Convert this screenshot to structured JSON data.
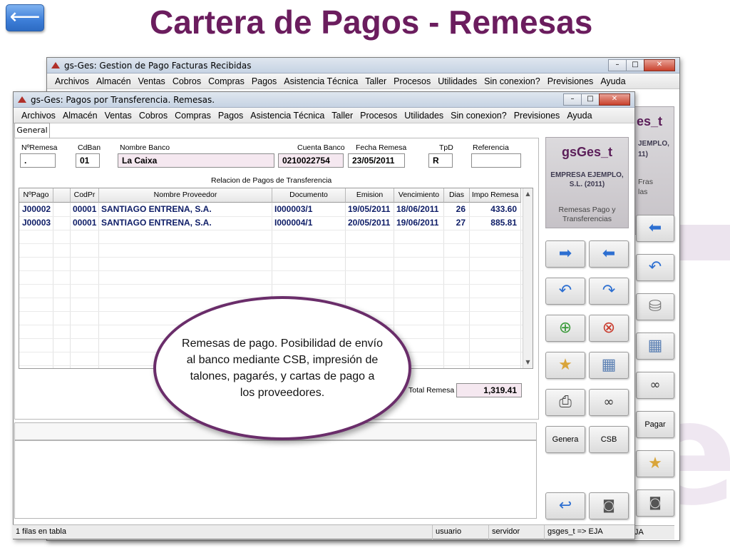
{
  "slide": {
    "title": "Cartera de Pagos - Remesas",
    "back_icon": "⟵",
    "watermark_letter": "e"
  },
  "bg_window": {
    "title": "gs-Ges: Gestion de Pago Facturas Recibidas",
    "menu": [
      "Archivos",
      "Almacén",
      "Ventas",
      "Cobros",
      "Compras",
      "Pagos",
      "Asistencia Técnica",
      "Taller",
      "Procesos",
      "Utilidades",
      "Sin conexion?",
      "Previsiones",
      "Ayuda"
    ],
    "logo_fragment": "es_t",
    "company_fragment": "JEMPLO,",
    "year_fragment": "11)",
    "fras_fragment": "Fras",
    "las_fragment": "las",
    "pagar_label": "Pagar",
    "status_fragment": "JA"
  },
  "window": {
    "title": "gs-Ges: Pagos por Transferencia. Remesas.",
    "menu": [
      "Archivos",
      "Almacén",
      "Ventas",
      "Cobros",
      "Compras",
      "Pagos",
      "Asistencia Técnica",
      "Taller",
      "Procesos",
      "Utilidades",
      "Sin conexion?",
      "Previsiones",
      "Ayuda"
    ],
    "controls": {
      "minimize": "–",
      "maximize": "□",
      "close": "✕"
    }
  },
  "tab_label": "General",
  "header_fields": {
    "nremesa": {
      "label": "NºRemesa",
      "value": "."
    },
    "cdban": {
      "label": "CdBan",
      "value": "01"
    },
    "nombre_banco": {
      "label": "Nombre Banco",
      "value": "La Caixa"
    },
    "cuenta_banco": {
      "label": "Cuenta Banco",
      "value": "0210022754"
    },
    "fecha_remesa": {
      "label": "Fecha Remesa",
      "value": "23/05/2011"
    },
    "tpd": {
      "label": "TpD",
      "value": "R"
    },
    "referencia": {
      "label": "Referencia",
      "value": ""
    }
  },
  "section_title": "Relacion de Pagos de Transferencia",
  "table": {
    "columns": [
      "NºPago",
      "",
      "CodPr",
      "Nombre Proveedor",
      "Documento",
      "Emision",
      "Vencimiento",
      "Dias",
      "Impo Remesa"
    ],
    "rows": [
      [
        "J00002",
        "",
        "00001",
        "SANTIAGO ENTRENA, S.A.",
        "I000003/1",
        "19/05/2011",
        "18/06/2011",
        "26",
        "433.60"
      ],
      [
        "J00003",
        "",
        "00001",
        "SANTIAGO ENTRENA, S.A.",
        "I000004/1",
        "20/05/2011",
        "19/06/2011",
        "27",
        "885.81"
      ]
    ]
  },
  "total": {
    "label": "Total Remesa",
    "value": "1,319.41"
  },
  "logo": {
    "title": "gsGes_t",
    "company": "EMPRESA EJEMPLO, S.L. (2011)",
    "subtitle": "Remesas Pago y Transferencias"
  },
  "buttons": {
    "genera": "Genera",
    "csb": "CSB"
  },
  "callout": "Remesas de pago. Posibilidad de envío al banco mediante CSB, impresión de talones, pagarés, y cartas de pago a los proveedores.",
  "status": {
    "rows": "1 filas en tabla",
    "user": "usuario",
    "server": "servidor",
    "db": "gsges_t => EJA"
  },
  "colors": {
    "title": "#6b1d5e",
    "grid_text": "#0d1c66",
    "accent_blue": "#2d6fd1"
  }
}
